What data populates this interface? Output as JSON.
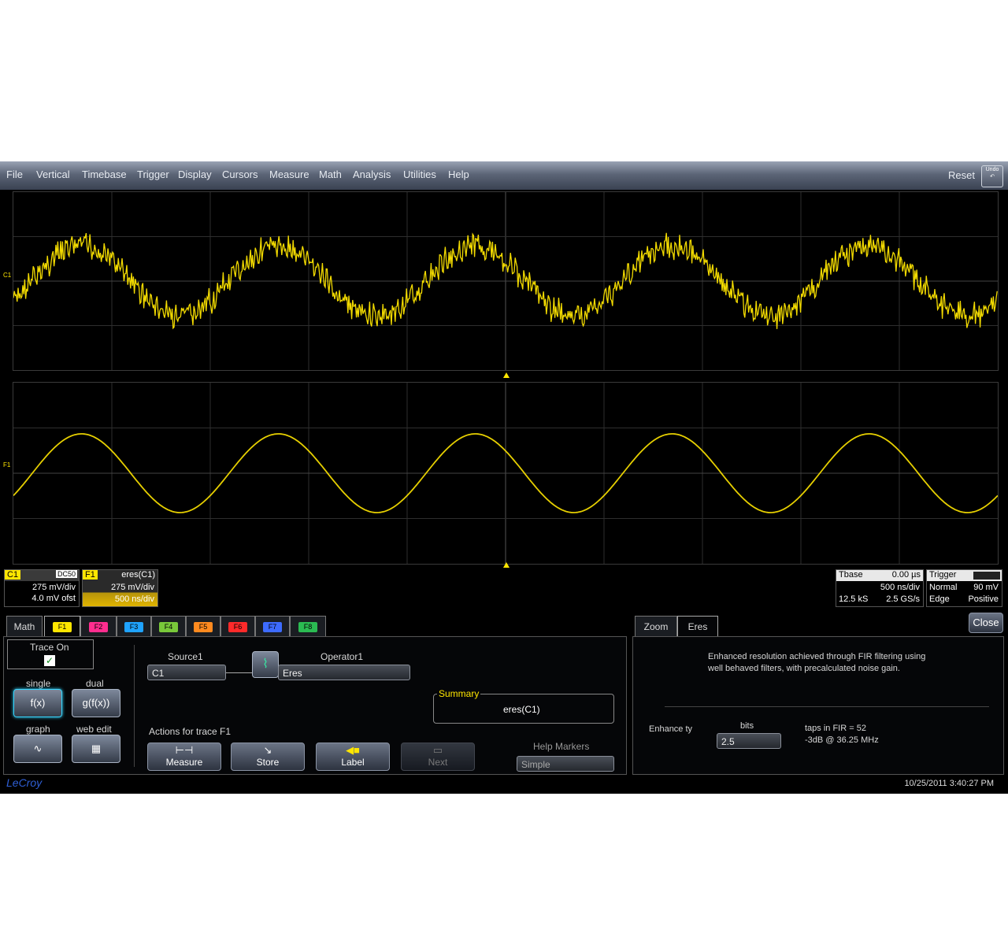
{
  "menu": [
    "File",
    "Vertical",
    "Timebase",
    "Trigger",
    "Display",
    "Cursors",
    "Measure",
    "Math",
    "Analysis",
    "Utilities",
    "Help"
  ],
  "menu_right": {
    "reset": "Reset",
    "undo": "Undo"
  },
  "channel_markers": {
    "c1": "C1",
    "f1": "F1"
  },
  "c1_descriptor": {
    "name": "C1",
    "coupling": "DC50",
    "scale": "275 mV/div",
    "offset": "4.0 mV ofst"
  },
  "f1_descriptor": {
    "name": "F1",
    "func": "eres(C1)",
    "scale": "275 mV/div",
    "timebase": "500 ns/div"
  },
  "timebase_descriptor": {
    "title": "Tbase",
    "delay": "0.00 µs",
    "tdiv": "500 ns/div",
    "samples": "12.5 kS",
    "rate": "2.5 GS/s"
  },
  "trigger_descriptor": {
    "title": "Trigger",
    "mode": "Normal",
    "level": "90 mV",
    "type": "Edge",
    "slope": "Positive"
  },
  "tabs": [
    {
      "label": "Math",
      "color": ""
    },
    {
      "label": "F1",
      "color": "#ffe600"
    },
    {
      "label": "F2",
      "color": "#ff2d8f"
    },
    {
      "label": "F3",
      "color": "#1fa3ff"
    },
    {
      "label": "F4",
      "color": "#79c83a"
    },
    {
      "label": "F5",
      "color": "#ff8a1f"
    },
    {
      "label": "F6",
      "color": "#ff2a2a"
    },
    {
      "label": "F7",
      "color": "#3d6bff"
    },
    {
      "label": "F8",
      "color": "#2bbb52"
    }
  ],
  "right_tabs": {
    "zoom": "Zoom",
    "eres": "Eres",
    "close": "Close"
  },
  "math_panel": {
    "trace_on": "Trace On",
    "single": "single",
    "single_icon": "f(x)",
    "dual": "dual",
    "dual_icon": "g(f(x))",
    "graph": "graph",
    "web_edit": "web edit",
    "source1_label": "Source1",
    "source1_value": "C1",
    "operator1_label": "Operator1",
    "operator1_value": "Eres",
    "summary_label": "Summary",
    "summary_value": "eres(C1)",
    "actions_label": "Actions for trace F1",
    "measure": "Measure",
    "store": "Store",
    "label": "Label",
    "next": "Next",
    "help_markers_label": "Help Markers",
    "help_markers_value": "Simple"
  },
  "eres_panel": {
    "description": "Enhanced resolution achieved through FIR filtering using well behaved filters, with precalculated noise gain.",
    "enhance_label": "Enhance ty",
    "bits_label": "bits",
    "bits_value": "2.5",
    "taps": "taps in FIR = 52",
    "bandwidth": "-3dB @ 36.25 MHz"
  },
  "footer": {
    "logo": "LeCroy",
    "timestamp": "10/25/2011 3:40:27 PM"
  },
  "colors": {
    "trace": "#ffe600",
    "grid": "#3a3a3a",
    "background": "#000000"
  }
}
